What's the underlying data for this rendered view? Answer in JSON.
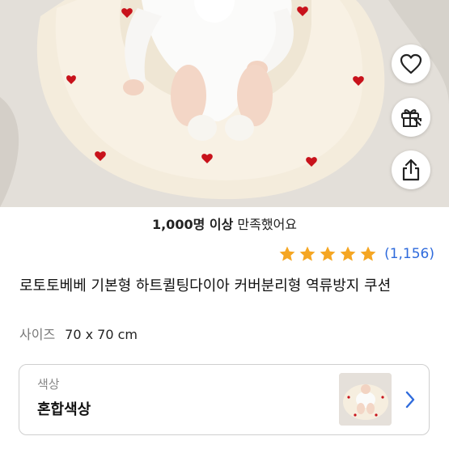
{
  "hero": {
    "image_alt": "baby lying on heart-quilted donut cushion",
    "actions": [
      {
        "name": "heart-icon",
        "label": "wishlist"
      },
      {
        "name": "gift-icon",
        "label": "gift"
      },
      {
        "name": "share-icon",
        "label": "share"
      }
    ]
  },
  "review": {
    "count_strong": "1,000명 이상",
    "satisfied_text": "만족했어요"
  },
  "rating": {
    "stars": 5,
    "star_color": "#f5a623",
    "count": "(1,156)",
    "count_color": "#2f6bdc"
  },
  "product": {
    "title": "로토토베베 기본형 하트퀼팅다이아 커버분리형 역류방지 쿠션",
    "size_label": "사이즈",
    "size_value": "70 x 70 cm"
  },
  "option": {
    "label": "색상",
    "value": "혼합색상"
  }
}
